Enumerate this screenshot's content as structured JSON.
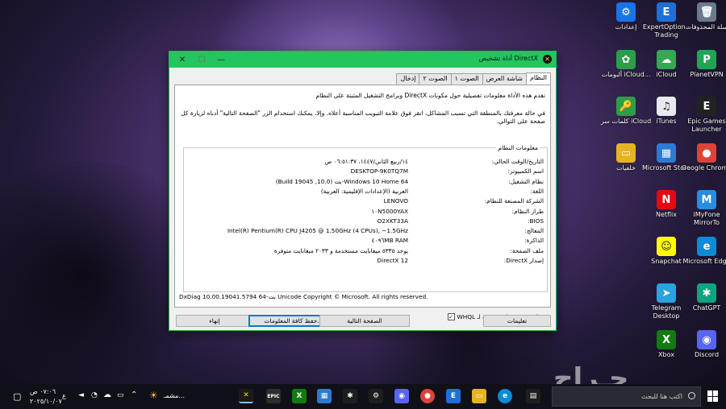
{
  "desktop": {
    "icons": [
      {
        "label": "سلة المحذوفات",
        "icon": "recycle-bin-icon",
        "color": "#6b7b8c",
        "glyph": "🗑"
      },
      {
        "label": "ExpertOption - Trading",
        "icon": "expertoption-icon",
        "color": "#1e6fd9",
        "glyph": "E"
      },
      {
        "label": "إعدادات",
        "icon": "settings-icon",
        "color": "#1a73e8",
        "glyph": "⚙"
      },
      {
        "label": "PlanetVPN",
        "icon": "planetvpn-icon",
        "color": "#23a455",
        "glyph": "P"
      },
      {
        "label": "iCloud",
        "icon": "icloud-icon",
        "color": "#34a853",
        "glyph": "☁"
      },
      {
        "label": "ألبومات iCloud...",
        "icon": "icloud-photos-icon",
        "color": "#2d9d4a",
        "glyph": "✿"
      },
      {
        "label": "Epic Games Launcher",
        "icon": "epic-games-icon",
        "color": "#222222",
        "glyph": "E"
      },
      {
        "label": "iTunes",
        "icon": "itunes-icon",
        "color": "#e8e8f0",
        "glyph": "♫"
      },
      {
        "label": "كلمات سر iCloud",
        "icon": "icloud-passwords-icon",
        "color": "#2d9d4a",
        "glyph": "🔑"
      },
      {
        "label": "Google Chrome",
        "icon": "chrome-icon",
        "color": "#db4437",
        "glyph": "●"
      },
      {
        "label": "Microsoft Store",
        "icon": "microsoft-store-icon",
        "color": "#2b7bd6",
        "glyph": "▦"
      },
      {
        "label": "خلفيات",
        "icon": "folder-icon",
        "color": "#e6b422",
        "glyph": "▭"
      },
      {
        "label": "iMyFone MirrorTo",
        "icon": "imyfone-icon",
        "color": "#2a8be0",
        "glyph": "M"
      },
      {
        "label": "Netflix",
        "icon": "netflix-icon",
        "color": "#e50914",
        "glyph": "N"
      },
      {
        "label": "Microsoft Edge",
        "icon": "edge-icon",
        "color": "#0c8bd6",
        "glyph": "e"
      },
      {
        "label": "Snapchat",
        "icon": "snapchat-icon",
        "color": "#fffc00",
        "glyph": "☺"
      },
      {
        "label": "ChatGPT",
        "icon": "chatgpt-icon",
        "color": "#10a37f",
        "glyph": "✱"
      },
      {
        "label": "Telegram Desktop",
        "icon": "telegram-icon",
        "color": "#2aa3e0",
        "glyph": "➤"
      },
      {
        "label": "Discord",
        "icon": "discord-icon",
        "color": "#5865f2",
        "glyph": "◉"
      },
      {
        "label": "Xbox",
        "icon": "xbox-icon",
        "color": "#107c10",
        "glyph": "X"
      }
    ]
  },
  "window": {
    "title": "أداة تشخيص DirectX",
    "tabs": [
      "النظام",
      "شاشة العرض",
      "الصوت ١",
      "الصوت ٢",
      "إدخال"
    ],
    "intro1": "تقدم هذه الأداة معلومات تفصيلية حول مكونات DirectX وبرامج التشغيل المثبتة على النظام",
    "intro2": "في حالة معرفتك بالمنطقة التي تسبب المشاكل، انقر فوق علامة التبويب المناسبة أعلاه. وإلا، يمكنك استخدام الزر \"الصفحة التالية\" أدناه لزيارة كل صفحة على التوالي.",
    "group_title": "معلومات النظام",
    "rows": [
      {
        "k": "التاريخ/الوقت الحالي:",
        "v": "١٤/ربيع الثاني/١٤٤٧، ٠٦:٥١:٣٧ ص"
      },
      {
        "k": "اسم الكمبيوتر:",
        "v": "DESKTOP-9K0TQ7M"
      },
      {
        "k": "نظام التشغيل:",
        "v": "Windows 10 Home 64-بت (10.0, Build 19045)"
      },
      {
        "k": "اللغة:",
        "v": "العربية (الإعدادات الإقليمية: العربية)"
      },
      {
        "k": "الشركة المصنعة للنظام:",
        "v": "LENOVO"
      },
      {
        "k": "طراز النظام:",
        "v": "١٠N5000YAX"
      },
      {
        "k": "BIOS:",
        "v": "O2XKT33A"
      },
      {
        "k": "المعالج:",
        "v": "Intel(R) Pentium(R) CPU J4205 @ 1.50GHz (4 CPUs), ~1.5GHz"
      },
      {
        "k": "الذاكرة:",
        "v": "٤٠٩٦MB RAM"
      },
      {
        "k": "ملف الصفحة:",
        "v": "يوجد ٥٣٣٥ ميغابايت مستخدمة و ٢٠٣٣ ميغابايت متوفرة"
      },
      {
        "k": "إصدار DirectX:",
        "v": "DirectX 12"
      }
    ],
    "whql": "البحث عن تواقيع رقمية لـ WHQL",
    "whql_checked": "✓",
    "copyright": "DxDiag 10.00.19041.5794 64-بت Unicode  Copyright © Microsoft.  All rights reserved.",
    "buttons": {
      "help": "تعليمات",
      "next": "الصفحة التالية",
      "save": "حفظ كافة المعلومات...",
      "exit": "إنهاء"
    }
  },
  "taskbar": {
    "search_placeholder": "اكتب هنا للبحث",
    "weather": "مشمـ...",
    "time": "٠٧:٠٦ ص",
    "date": "٢٠٢٥/١٠/٠٧",
    "lang": "ع"
  },
  "watermark": "حـراج"
}
